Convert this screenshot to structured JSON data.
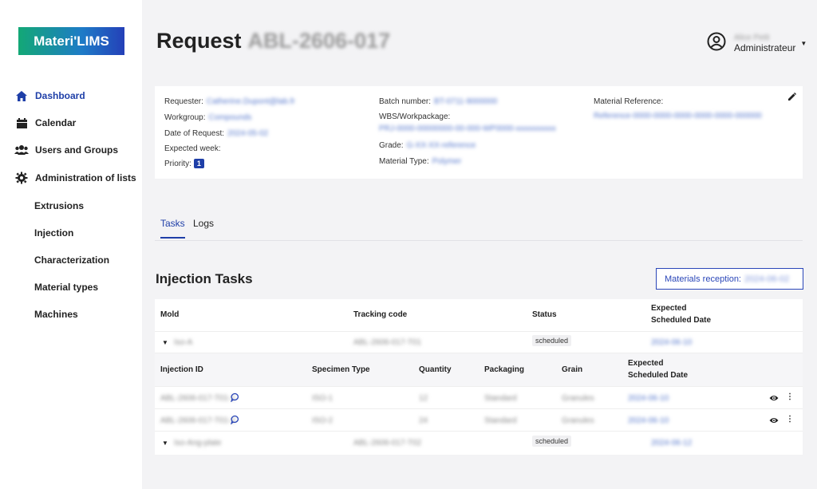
{
  "app": {
    "logo": "Materi'LIMS"
  },
  "sidebar": {
    "items": [
      {
        "label": "Dashboard",
        "icon": "home-icon"
      },
      {
        "label": "Calendar",
        "icon": "calendar-icon"
      },
      {
        "label": "Users and Groups",
        "icon": "users-icon"
      },
      {
        "label": "Administration of lists",
        "icon": "gear-icon"
      }
    ],
    "subitems": [
      "Extrusions",
      "Injection",
      "Characterization",
      "Material types",
      "Machines"
    ]
  },
  "header": {
    "title": "Request",
    "title_id": "ABL-2606-017",
    "user_name": "Alice Petit",
    "user_role": "Administrateur"
  },
  "info": {
    "requester_label": "Requester:",
    "requester_value": "Catherine.Dupont@lab.fr",
    "workgroup_label": "Workgroup:",
    "workgroup_value": "Compounds",
    "date_label": "Date of Request:",
    "date_value": "2024-05-02",
    "expected_week_label": "Expected week:",
    "priority_label": "Priority:",
    "priority_value": "1",
    "batch_label": "Batch number:",
    "batch_value": "BT-0711-9000000",
    "wbs_label": "WBS/Workpackage:",
    "wbs_value": "PRJ-0000-00000000-00-000-WP0000-xxxxxxxxxx",
    "grade_label": "Grade:",
    "grade_value": "G-XX-XX-reference",
    "material_type_label": "Material Type:",
    "material_type_value": "Polymer",
    "material_ref_label": "Material Reference:",
    "material_ref_value": "Reference-0000-0000-0000-0000-0000-000000"
  },
  "tabs": [
    {
      "label": "Tasks"
    },
    {
      "label": "Logs"
    }
  ],
  "section": {
    "title": "Injection Tasks",
    "reception_label": "Materials reception:",
    "reception_value": "2024-06-02"
  },
  "table": {
    "headers": {
      "mold": "Mold",
      "tracking": "Tracking code",
      "status": "Status",
      "expected_1": "Expected",
      "expected_2": "Scheduled Date"
    },
    "groups": [
      {
        "mold": "Iso-A",
        "tracking": "ABL-2606-017-T01",
        "status": "scheduled",
        "date": "2024-06-10"
      },
      {
        "mold": "Iso-Ang-plate",
        "tracking": "ABL-2606-017-T02",
        "status": "scheduled",
        "date": "2024-06-12"
      }
    ],
    "sub_headers": {
      "injection_id": "Injection ID",
      "specimen": "Specimen Type",
      "quantity": "Quantity",
      "packaging": "Packaging",
      "grain": "Grain",
      "expected_1": "Expected",
      "expected_2": "Scheduled Date"
    },
    "sub_rows": [
      {
        "id": "ABL-2606-017-T01-1",
        "specimen": "ISO-1",
        "quantity": "12",
        "packaging": "Standard",
        "grain": "Granules",
        "date": "2024-06-10"
      },
      {
        "id": "ABL-2606-017-T01-2",
        "specimen": "ISO-2",
        "quantity": "24",
        "packaging": "Standard",
        "grain": "Granules",
        "date": "2024-06-10"
      }
    ]
  },
  "colors": {
    "accent": "#1f3fa8",
    "background": "#f3f3f5"
  }
}
